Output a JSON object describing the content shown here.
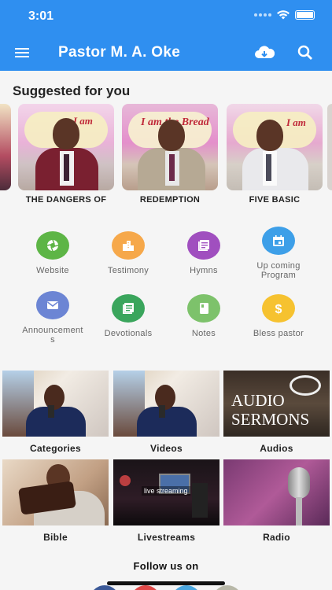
{
  "status_bar": {
    "time": "3:01"
  },
  "app_bar": {
    "title": "Pastor M. A. Oke",
    "menu_icon": "hamburger-menu-icon",
    "download_icon": "cloud-download-icon",
    "search_icon": "search-icon"
  },
  "suggested": {
    "title": "Suggested for you",
    "items": [
      {
        "label": "THE DANGERS OF",
        "banner": "I am"
      },
      {
        "label": "REDEMPTION",
        "banner": "I am the Bread"
      },
      {
        "label": "FIVE BASIC",
        "banner": "I am"
      }
    ]
  },
  "menu": [
    {
      "label": "Website",
      "icon": "camera-aperture-icon",
      "color": "#5db546"
    },
    {
      "label": "Testimony",
      "icon": "buildings-icon",
      "color": "#f6a84a"
    },
    {
      "label": "Hymns",
      "icon": "library-books-icon",
      "color": "#a04fbf"
    },
    {
      "label": "Up coming Program",
      "icon": "calendar-icon",
      "color": "#3d9fe8"
    },
    {
      "label": "Announcements",
      "icon": "mail-icon",
      "color": "#6c85d4"
    },
    {
      "label": "Devotionals",
      "icon": "library-books-icon",
      "color": "#3aa55c"
    },
    {
      "label": "Notes",
      "icon": "book-icon",
      "color": "#7dc26b"
    },
    {
      "label": "Bless pastor",
      "icon": "dollar-icon",
      "color": "#f6c230"
    }
  ],
  "media": [
    {
      "label": "Categories"
    },
    {
      "label": "Videos"
    },
    {
      "label": "Audios",
      "overlay": "AUDIO SERMONS"
    },
    {
      "label": "Bible"
    },
    {
      "label": "Livestreams",
      "overlay": "live streaming"
    },
    {
      "label": "Radio"
    }
  ],
  "follow": {
    "title": "Follow us on"
  },
  "colors": {
    "primary": "#2f8ff0"
  }
}
